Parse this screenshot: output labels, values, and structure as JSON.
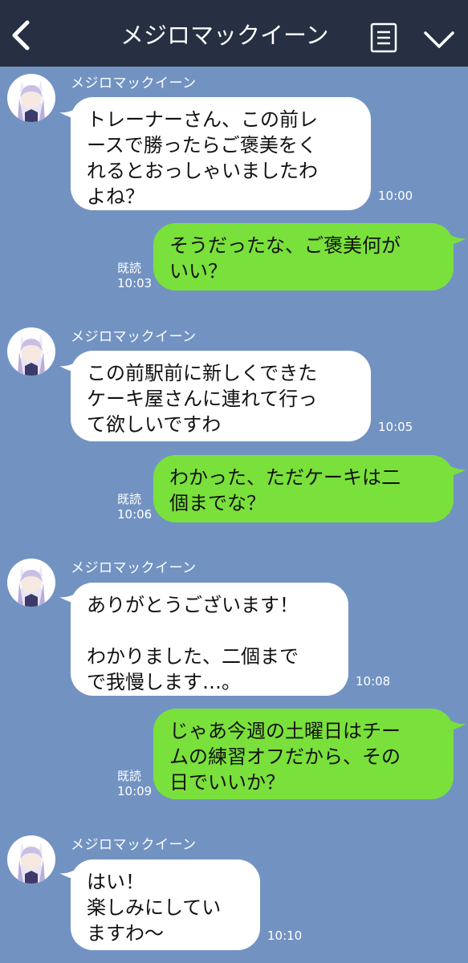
{
  "header": {
    "title": "メジロマックイーン",
    "back_icon": "chevron-left-icon",
    "note_icon": "note-icon",
    "menu_icon": "chevron-down-icon",
    "bg_color": "#263042"
  },
  "colors": {
    "chat_bg": "#7293c2",
    "incoming_bubble": "#ffffff",
    "outgoing_bubble": "#7ae03b"
  },
  "messages": [
    {
      "direction": "incoming",
      "sender": "メジロマックイーン",
      "text": "トレーナーさん、この前レ\nースで勝ったらご褒美をく\nれるとおっしゃいましたわ\nよね？",
      "time": "10:00"
    },
    {
      "direction": "outgoing",
      "text": "そうだったな、ご褒美何が\nいい？",
      "read": "既読",
      "time": "10:03"
    },
    {
      "direction": "incoming",
      "sender": "メジロマックイーン",
      "text": "この前駅前に新しくできた\nケーキ屋さんに連れて行っ\nて欲しいですわ",
      "time": "10:05"
    },
    {
      "direction": "outgoing",
      "text": "わかった、ただケーキは二\n個までな？",
      "read": "既読",
      "time": "10:06"
    },
    {
      "direction": "incoming",
      "sender": "メジロマックイーン",
      "text": "ありがとうございます！\n\nわかりました、二個まで\nで我慢します…。",
      "time": "10:08"
    },
    {
      "direction": "outgoing",
      "text": "じゃあ今週の土曜日はチー\nムの練習オフだから、その\n日でいいか？",
      "read": "既読",
      "time": "10:09"
    },
    {
      "direction": "incoming",
      "sender": "メジロマックイーン",
      "text": "はい！\n楽しみにしてい\nますわ〜",
      "time": "10:10"
    }
  ]
}
